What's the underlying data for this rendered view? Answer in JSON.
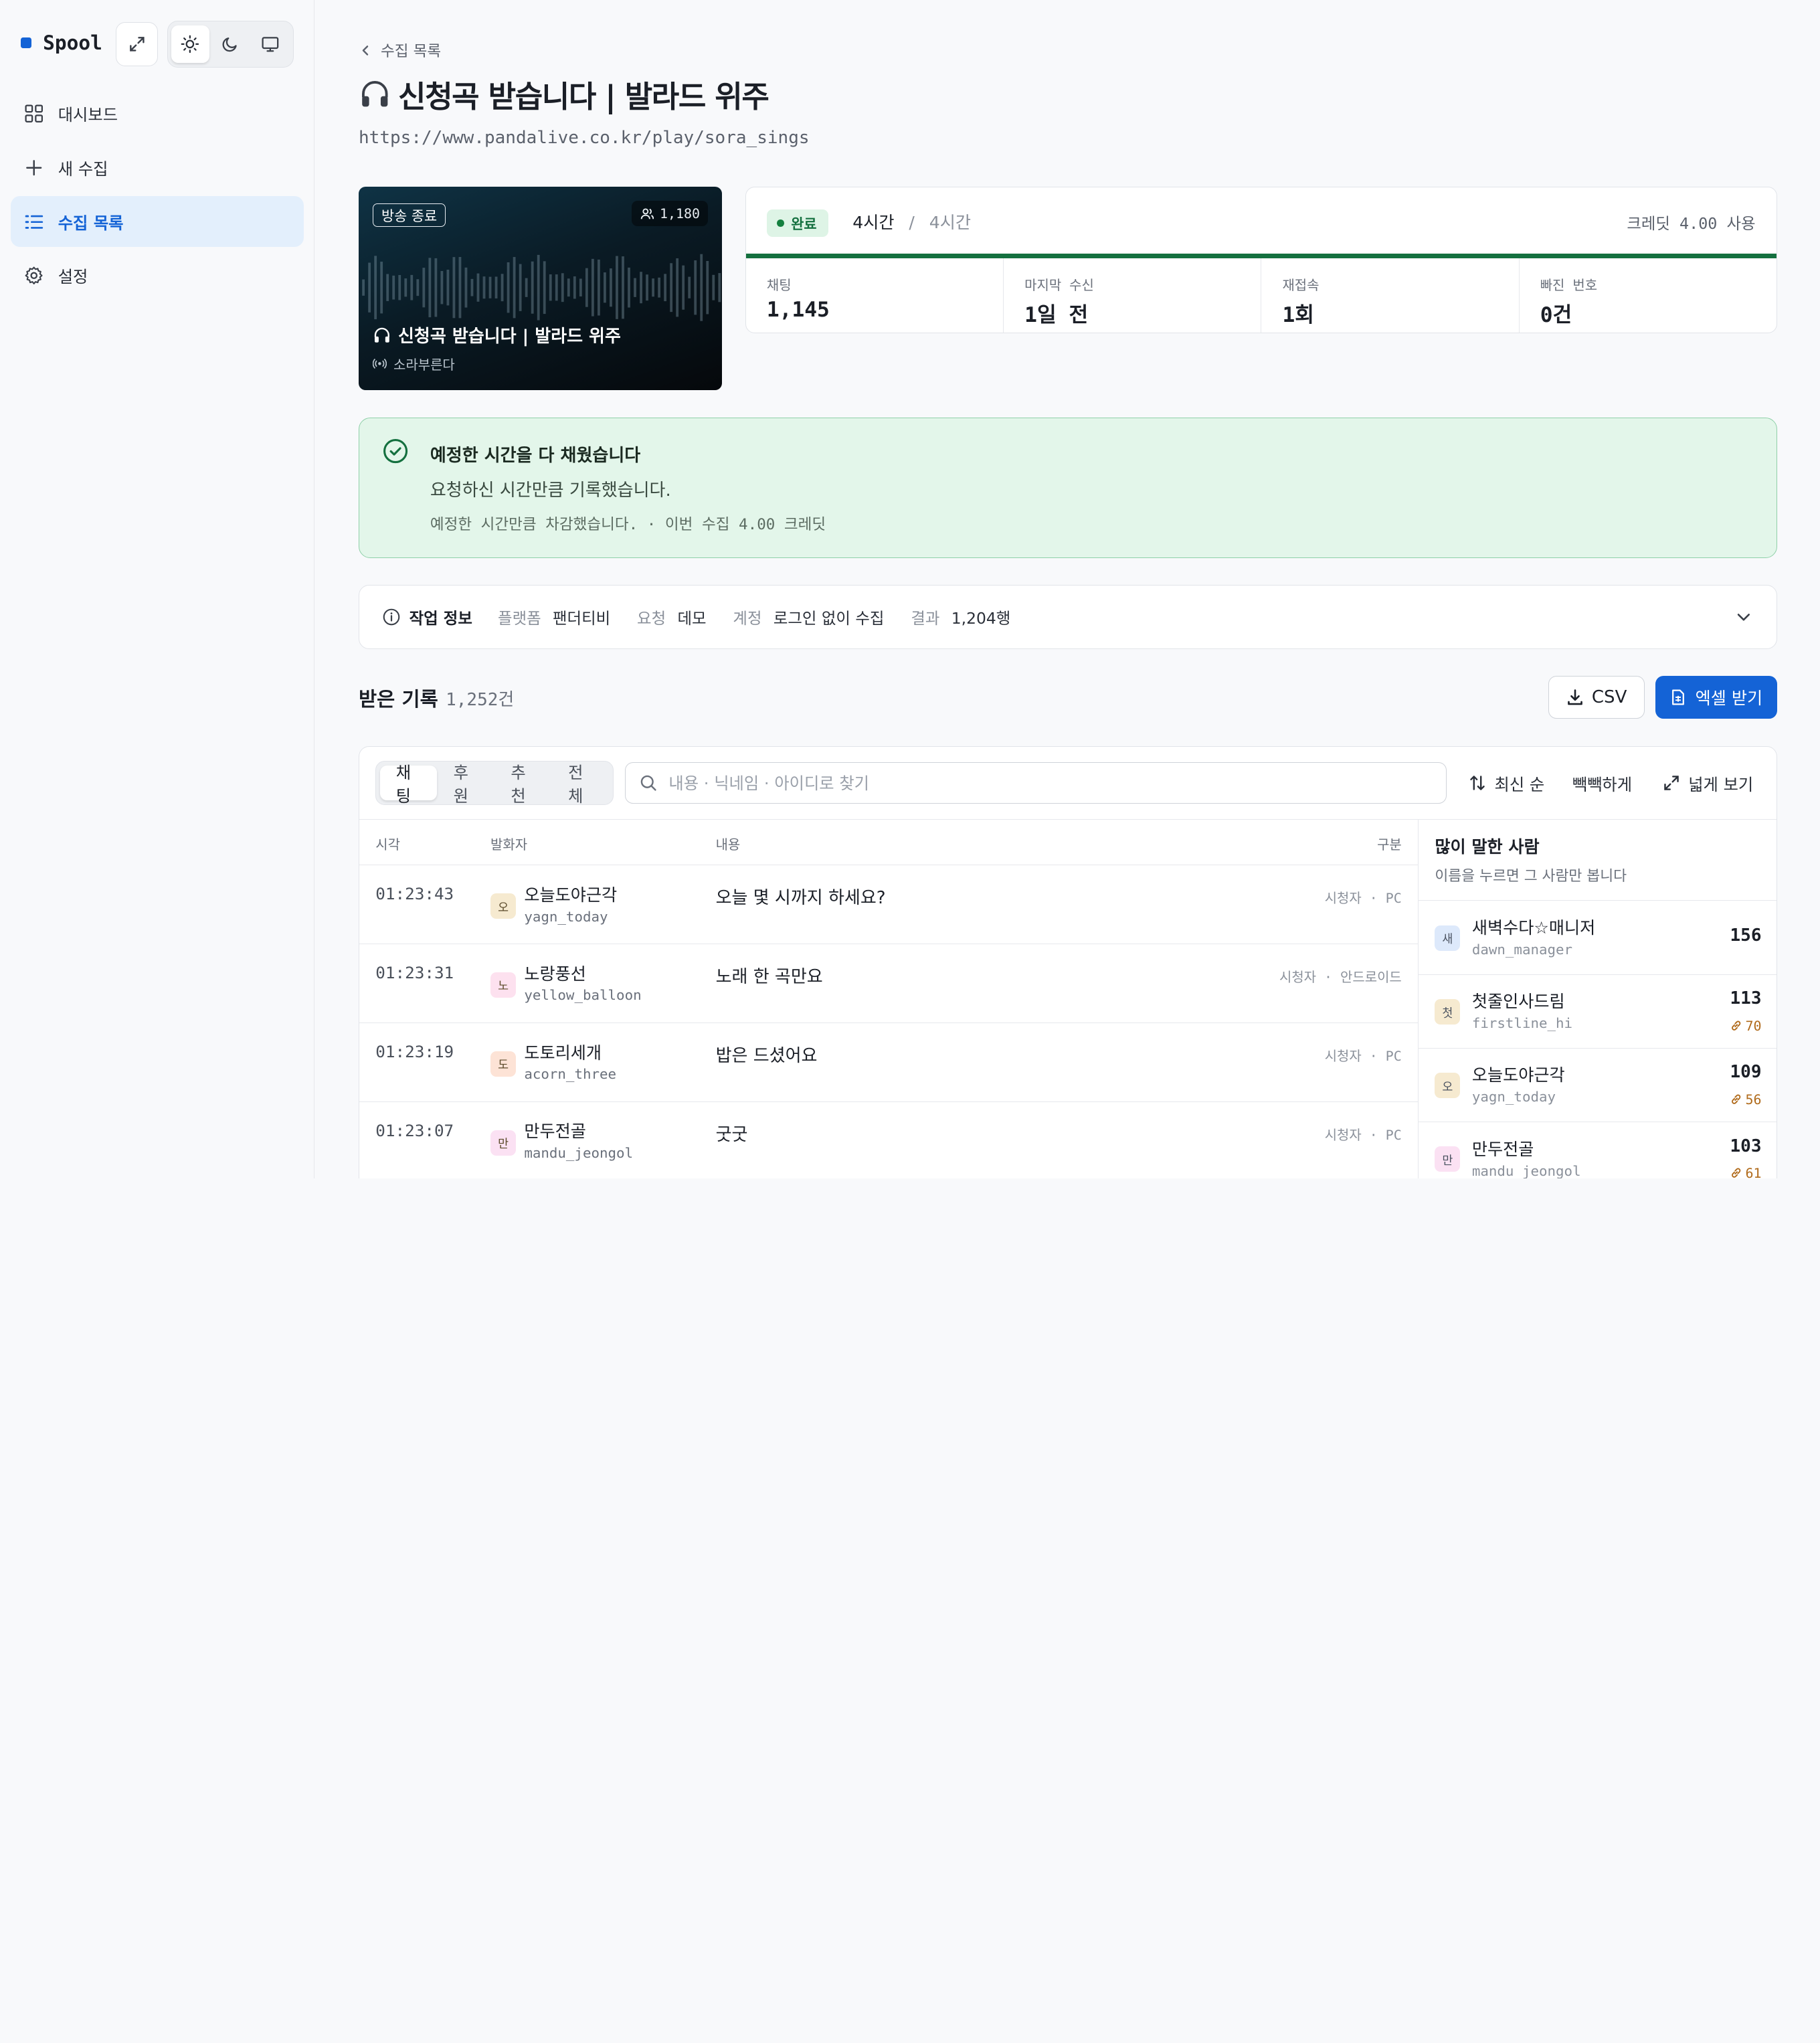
{
  "sidebar": {
    "brand": "Spool",
    "items": [
      {
        "label": "대시보드",
        "icon": "grid-icon"
      },
      {
        "label": "새 수집",
        "icon": "plus-icon"
      },
      {
        "label": "수집 목록",
        "icon": "list-icon",
        "active": true
      },
      {
        "label": "설정",
        "icon": "gear-icon"
      }
    ],
    "theme": {
      "active": "light",
      "options": [
        "light",
        "dark",
        "system"
      ]
    }
  },
  "header": {
    "back_label": "수집 목록",
    "title": "신청곡 받습니다 | 발라드 위주",
    "url": "https://www.pandalive.co.kr/play/sora_sings"
  },
  "thumbnail": {
    "badge": "방송 종료",
    "viewers": "1,180",
    "title": "신청곡 받습니다 | 발라드 위주",
    "host": "소라부른다"
  },
  "status": {
    "pill": "완료",
    "elapsed": "4시간",
    "separator": "/",
    "total": "4시간",
    "credit": "크레딧 4.00 사용",
    "progress": 1.0,
    "accent": "#14703f",
    "stats": [
      {
        "label": "채팅",
        "value": "1,145"
      },
      {
        "label": "마지막 수신",
        "value": "1일 전"
      },
      {
        "label": "재접속",
        "value": "1회"
      },
      {
        "label": "빠진 번호",
        "value": "0건"
      }
    ]
  },
  "notice": {
    "title": "예정한 시간을 다 채웠습니다",
    "body": "요청하신 시간만큼 기록했습니다.",
    "note": "예정한 시간만큼 차감했습니다. · 이번 수집 4.00 크레딧"
  },
  "job": {
    "title": "작업 정보",
    "fields": [
      {
        "key": "플랫폼",
        "value": "팬더티비"
      },
      {
        "key": "요청",
        "value": "데모"
      },
      {
        "key": "계정",
        "value": "로그인 없이 수집"
      },
      {
        "key": "결과",
        "value": "1,204행"
      }
    ]
  },
  "records": {
    "title": "받은 기록",
    "count": "1,252건",
    "csv_label": "CSV",
    "excel_label": "엑셀 받기",
    "tabs": [
      "채팅",
      "후원",
      "추천",
      "전체"
    ],
    "active_tab": "채팅",
    "search_placeholder": "내용 · 닉네임 · 아이디로 찾기",
    "sort_label": "최신 순",
    "density_label": "빽빽하게",
    "expand_label": "넓게 보기",
    "columns": [
      "시각",
      "발화자",
      "내용",
      "구분"
    ],
    "rows": [
      {
        "time": "01:23:43",
        "initial": "오",
        "name": "오늘도야근각",
        "id": "yagn_today",
        "message": "오늘 몇 시까지 하세요?",
        "kind": "시청자 · PC",
        "color": "#f6ead0"
      },
      {
        "time": "01:23:31",
        "initial": "노",
        "name": "노랑풍선",
        "id": "yellow_balloon",
        "message": "노래 한 곡만요",
        "kind": "시청자 · 안드로이드",
        "color": "#fde1ef"
      },
      {
        "time": "01:23:19",
        "initial": "도",
        "name": "도토리세개",
        "id": "acorn_three",
        "message": "밥은 드셨어요",
        "kind": "시청자 · PC",
        "color": "#fde3d6"
      },
      {
        "time": "01:23:07",
        "initial": "만",
        "name": "만두전골",
        "id": "mandu_jeongol",
        "message": "굿굿",
        "kind": "시청자 · PC",
        "color": "#fbe1f3"
      }
    ]
  },
  "top_speakers": {
    "title": "많이 말한 사람",
    "subtitle": "이름을 누르면 그 사람만 봅니다",
    "items": [
      {
        "initial": "새",
        "name": "새벽수다☆매니저",
        "id": "dawn_manager",
        "count": "156",
        "sub": "",
        "color": "#dde9fb"
      },
      {
        "initial": "첫",
        "name": "첫줄인사드림",
        "id": "firstline_hi",
        "count": "113",
        "sub": "70",
        "color": "#f6ead0"
      },
      {
        "initial": "오",
        "name": "오늘도야근각",
        "id": "yagn_today",
        "count": "109",
        "sub": "56",
        "color": "#f6ead0"
      },
      {
        "initial": "만",
        "name": "만두전골",
        "id": "mandu_jeongol",
        "count": "103",
        "sub": "61",
        "color": "#fbe1f3"
      }
    ]
  }
}
